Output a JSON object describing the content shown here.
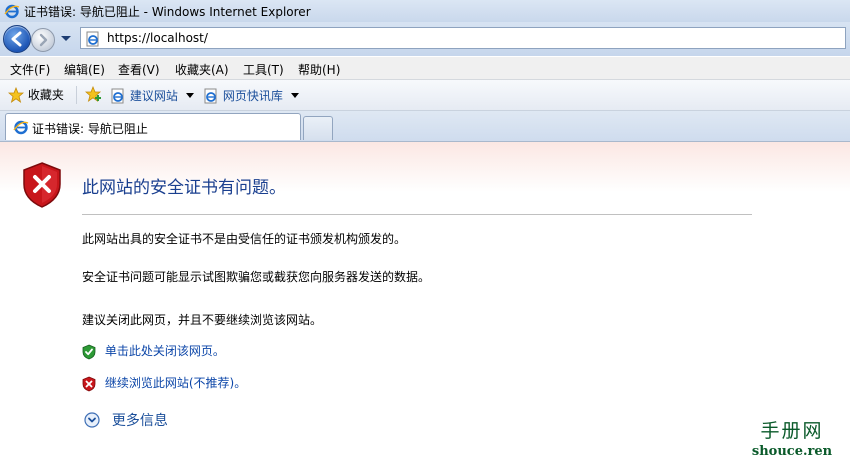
{
  "window": {
    "title": "证书错误: 导航已阻止 - Windows Internet Explorer"
  },
  "address_bar": {
    "url": "https://localhost/"
  },
  "menu": {
    "items": [
      {
        "id": "file",
        "label": "文件(F)"
      },
      {
        "id": "edit",
        "label": "编辑(E)"
      },
      {
        "id": "view",
        "label": "查看(V)"
      },
      {
        "id": "favorites",
        "label": "收藏夹(A)"
      },
      {
        "id": "tools",
        "label": "工具(T)"
      },
      {
        "id": "help",
        "label": "帮助(H)"
      }
    ]
  },
  "favorites_bar": {
    "favorites_label": "收藏夹",
    "links": [
      {
        "label": "建议网站"
      },
      {
        "label": "网页快讯库"
      }
    ]
  },
  "tabs": {
    "active_label": "证书错误: 导航已阻止"
  },
  "error_page": {
    "title": "此网站的安全证书有问题。",
    "paragraphs": [
      "此网站出具的安全证书不是由受信任的证书颁发机构颁发的。",
      "安全证书问题可能显示试图欺骗您或截获您向服务器发送的数据。",
      "建议关闭此网页，并且不要继续浏览该网站。"
    ],
    "close_link": "单击此处关闭该网页。",
    "continue_link": "继续浏览此网站(不推荐)。",
    "more_info": "更多信息"
  },
  "watermark": {
    "line1": "手册网",
    "line2": "shouce.ren"
  },
  "icons": {
    "shield_error": "shield-error-icon",
    "shield_ok": "shield-ok-icon",
    "ie_logo": "ie-icon",
    "favorites_star": "star-icon"
  },
  "colors": {
    "error_red": "#c8161b",
    "ok_green": "#2d9a35",
    "link_blue": "#0c46a8",
    "title_blue": "#1a3f8f"
  }
}
